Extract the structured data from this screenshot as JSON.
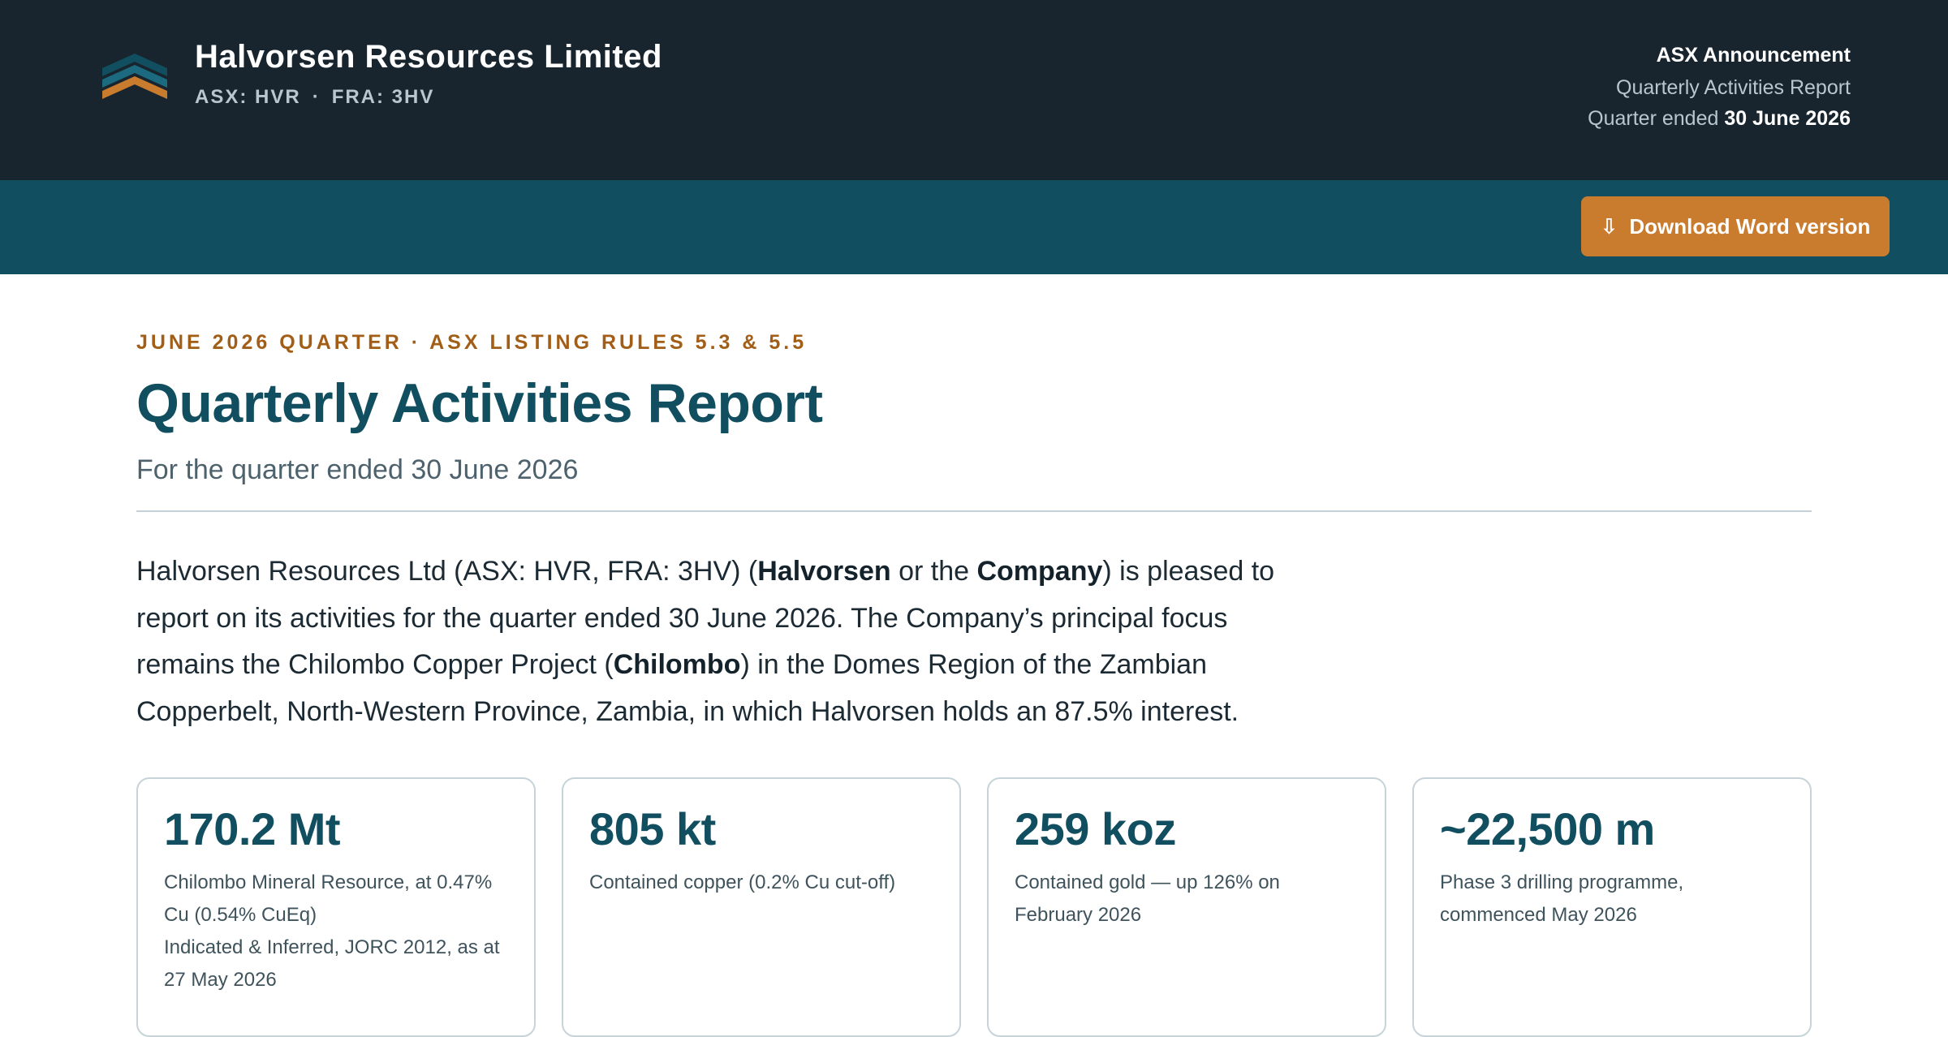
{
  "header": {
    "company_name": "Halvorsen Resources Limited",
    "ticker_asx": "ASX: HVR",
    "ticker_separator": "·",
    "ticker_fra": "FRA: 3HV",
    "announcement_label": "ASX Announcement",
    "report_name": "Quarterly Activities Report",
    "quarter_prefix": "Quarter ended",
    "quarter_date": "30 June 2026"
  },
  "toolbar": {
    "download_icon": "download-arrow-icon",
    "download_label": "Download Word version"
  },
  "document": {
    "eyebrow": "JUNE 2026 QUARTER · ASX LISTING RULES 5.3 & 5.5",
    "title": "Quarterly Activities Report",
    "subtitle": "For the quarter ended 30 June 2026",
    "intro": {
      "t1": "Halvorsen Resources Ltd (ASX: HVR, FRA: 3HV) (",
      "b1": "Halvorsen",
      "t2": " or the ",
      "b2": "Company",
      "t3": ") is pleased to report on its activities for the quarter ended 30 June 2026. The Company’s principal focus remains the Chilombo Copper Project (",
      "b3": "Chilombo",
      "t4": ") in the Domes Region of the Zambian Copperbelt, North-Western Province, Zambia, in which Halvorsen holds an 87.5% interest."
    }
  },
  "stats": [
    {
      "value": "170.2 Mt",
      "description": "Chilombo Mineral Resource, at 0.47% Cu (0.54% CuEq)",
      "note": "Indicated & Inferred, JORC 2012, as at 27 May 2026"
    },
    {
      "value": "805 kt",
      "description": "Contained copper (0.2% Cu cut-off)",
      "note": ""
    },
    {
      "value": "259 koz",
      "description": "Contained gold — up 126% on February 2026",
      "note": ""
    },
    {
      "value": "~22,500 m",
      "description": "Phase 3 drilling programme, commenced May 2026",
      "note": ""
    }
  ],
  "colors": {
    "header_bg": "#18252e",
    "toolbar_bg": "#114e5f",
    "accent_orange": "#c97b2e",
    "title_teal": "#114e5f",
    "eyebrow_brown": "#a25e16"
  }
}
